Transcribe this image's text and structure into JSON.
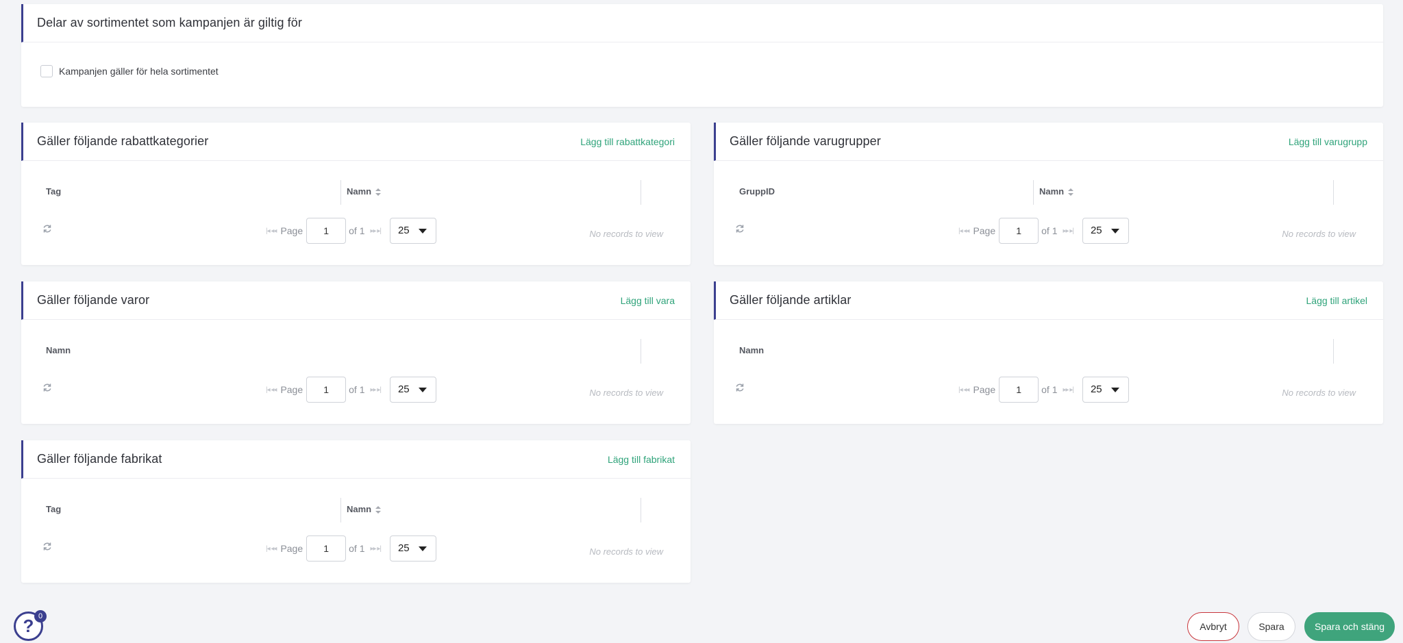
{
  "assortment": {
    "title": "Delar av sortimentet som kampanjen är giltig för",
    "checkbox_label": "Kampanjen gäller för hela sortimentet"
  },
  "pager": {
    "page_label": "Page",
    "page_value": "1",
    "of_label": "of 1",
    "rows_value": "25",
    "no_records": "No records to view"
  },
  "cards": {
    "rabattkategorier": {
      "title": "Gäller följande rabattkategorier",
      "link": "Lägg till rabattkategori",
      "col1": "Tag",
      "col2": "Namn"
    },
    "varugrupper": {
      "title": "Gäller följande varugrupper",
      "link": "Lägg till varugrupp",
      "col1": "GruppID",
      "col2": "Namn"
    },
    "varor": {
      "title": "Gäller följande varor",
      "link": "Lägg till vara",
      "col1": "Namn"
    },
    "artiklar": {
      "title": "Gäller följande artiklar",
      "link": "Lägg till artikel",
      "col1": "Namn"
    },
    "fabrikat": {
      "title": "Gäller följande fabrikat",
      "link": "Lägg till fabrikat",
      "col1": "Tag",
      "col2": "Namn"
    }
  },
  "help": {
    "badge_count": "0"
  },
  "footer": {
    "cancel_label": "Avbryt",
    "save_label": "Spara",
    "save_close_label": "Spara och stäng"
  },
  "colors": {
    "accent": "#3b3f8f",
    "link_green": "#2fa37a",
    "primary_button": "#3fa47c",
    "cancel_border": "#c8353b"
  }
}
